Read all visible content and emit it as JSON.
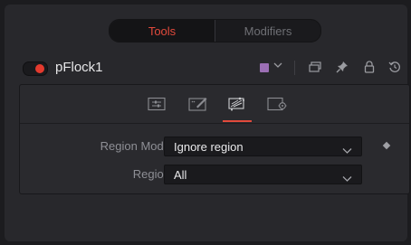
{
  "top_tabs": {
    "tools": "Tools",
    "modifiers": "Modifiers"
  },
  "node": {
    "name": "pFlock1",
    "color": "#9b6fb4"
  },
  "header_icons": [
    "versions-icon",
    "pin-icon",
    "lock-icon",
    "reset-icon"
  ],
  "inspector_tabs": [
    "controls-tab",
    "style-tab",
    "region-tab",
    "settings-tab"
  ],
  "fields": {
    "region_mode": {
      "label": "Region Mode",
      "value": "Ignore region"
    },
    "region": {
      "label": "Region",
      "value": "All"
    }
  },
  "colors": {
    "accent": "#e14a3c",
    "toggle_on": "#e43a2e"
  }
}
